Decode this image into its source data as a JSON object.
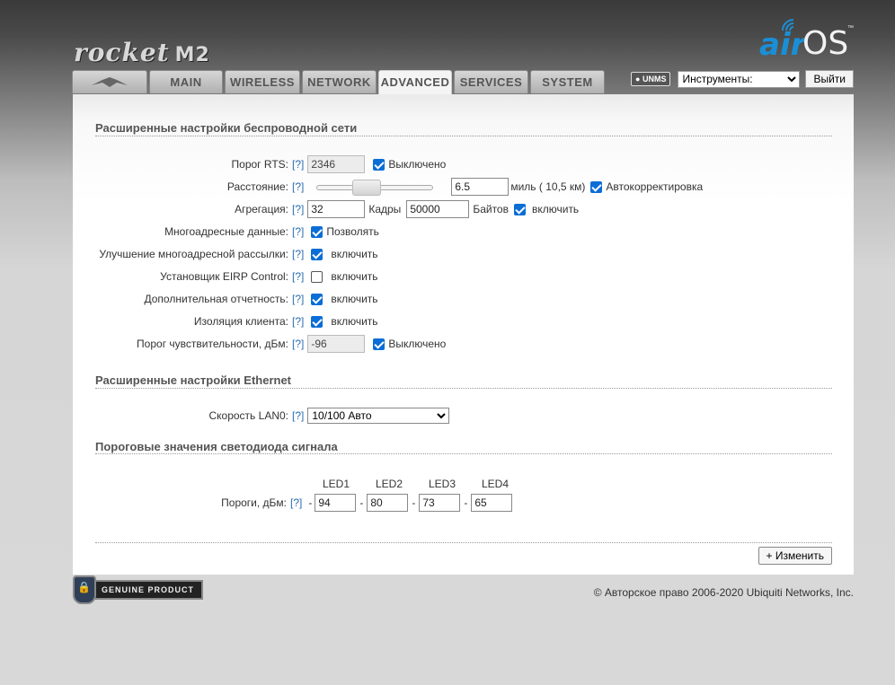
{
  "brand": {
    "product": "rocket",
    "model": "M2",
    "os_prefix": "air",
    "os_suffix": "OS",
    "tm": "™"
  },
  "tabs": [
    {
      "label": "",
      "icon": "ubiquiti-logo-icon"
    },
    {
      "label": "MAIN"
    },
    {
      "label": "WIRELESS"
    },
    {
      "label": "NETWORK"
    },
    {
      "label": "ADVANCED",
      "active": true
    },
    {
      "label": "SERVICES"
    },
    {
      "label": "SYSTEM"
    }
  ],
  "topbar": {
    "unms": "UNMS",
    "tools": "Инструменты:",
    "logout": "Выйти"
  },
  "wireless": {
    "title": "Расширенные настройки беспроводной сети",
    "help": "[?]",
    "rts": {
      "label": "Порог RTS:",
      "value": "2346",
      "cb_label": "Выключено"
    },
    "distance": {
      "label": "Расстояние:",
      "value": "6.5",
      "unit": "миль ( 10,5 км)",
      "cb_label": "Автокорректировка"
    },
    "aggregation": {
      "label": "Агрегация:",
      "frames": "32",
      "frames_unit": "Кадры",
      "bytes": "50000",
      "bytes_unit": "Байтов",
      "cb_label": "включить"
    },
    "multicast": {
      "label": "Многоадресные данные:",
      "cb_label": "Позволять"
    },
    "multicast_enh": {
      "label": "Улучшение многоадресной рассылки:",
      "cb_label": "включить"
    },
    "eirp": {
      "label": "Установщик EIRP Control:",
      "cb_label": "включить"
    },
    "extra_report": {
      "label": "Дополнительная отчетность:",
      "cb_label": "включить"
    },
    "isolation": {
      "label": "Изоляция клиента:",
      "cb_label": "включить"
    },
    "sensitivity": {
      "label": "Порог чувствительности, дБм:",
      "value": "-96",
      "cb_label": "Выключено"
    }
  },
  "ethernet": {
    "title": "Расширенные настройки Ethernet",
    "lan_label": "Скорость LAN0:",
    "lan_value": "10/100 Авто"
  },
  "led": {
    "title": "Пороговые значения светодиода сигнала",
    "label": "Пороги, дБм:",
    "dash": "-",
    "headers": [
      "LED1",
      "LED2",
      "LED3",
      "LED4"
    ],
    "values": [
      "94",
      "80",
      "73",
      "65"
    ]
  },
  "change_button": "+ Изменить",
  "genuine": "GENUINE PRODUCT",
  "copyright": "© Авторское право 2006-2020 Ubiquiti Networks, Inc."
}
